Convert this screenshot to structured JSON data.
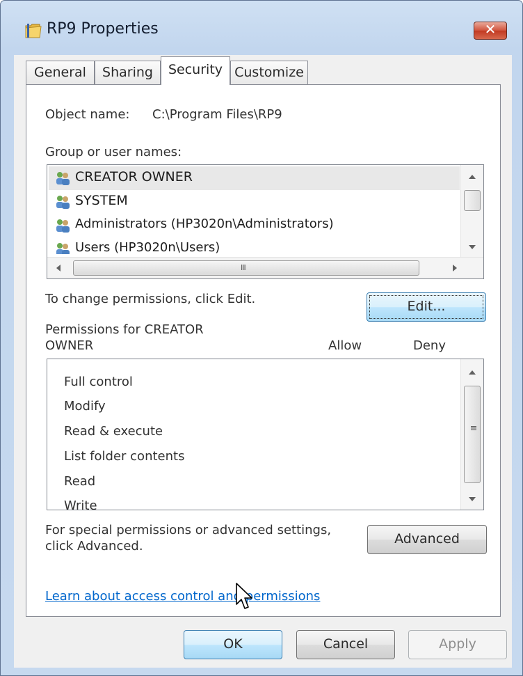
{
  "window": {
    "title": "RP9 Properties",
    "close_label": "✕"
  },
  "tabs": [
    {
      "label": "General"
    },
    {
      "label": "Sharing"
    },
    {
      "label": "Security",
      "active": true
    },
    {
      "label": "Customize"
    }
  ],
  "security": {
    "object_name_label": "Object name:",
    "object_name_value": "C:\\Program Files\\RP9",
    "group_label": "Group or user names:",
    "users": [
      {
        "name": "CREATOR OWNER",
        "selected": true
      },
      {
        "name": "SYSTEM"
      },
      {
        "name": "Administrators (HP3020n\\Administrators)"
      },
      {
        "name": "Users (HP3020n\\Users)"
      }
    ],
    "change_text": "To change permissions, click Edit.",
    "edit_label": "Edit...",
    "permissions_label_line1": "Permissions for CREATOR",
    "permissions_label_line2": "OWNER",
    "allow_header": "Allow",
    "deny_header": "Deny",
    "permissions": [
      "Full control",
      "Modify",
      "Read & execute",
      "List folder contents",
      "Read",
      "Write"
    ],
    "special_text_line1": "For special permissions or advanced settings,",
    "special_text_line2": "click Advanced.",
    "advanced_label": "Advanced",
    "learn_link": "Learn about access control and permissions"
  },
  "footer": {
    "ok_label": "OK",
    "cancel_label": "Cancel",
    "apply_label": "Apply"
  },
  "scrollbar_grip": "III",
  "colors": {
    "link": "#0066cc",
    "focus_button": "#bee6fd",
    "close_button": "#c23a22"
  }
}
